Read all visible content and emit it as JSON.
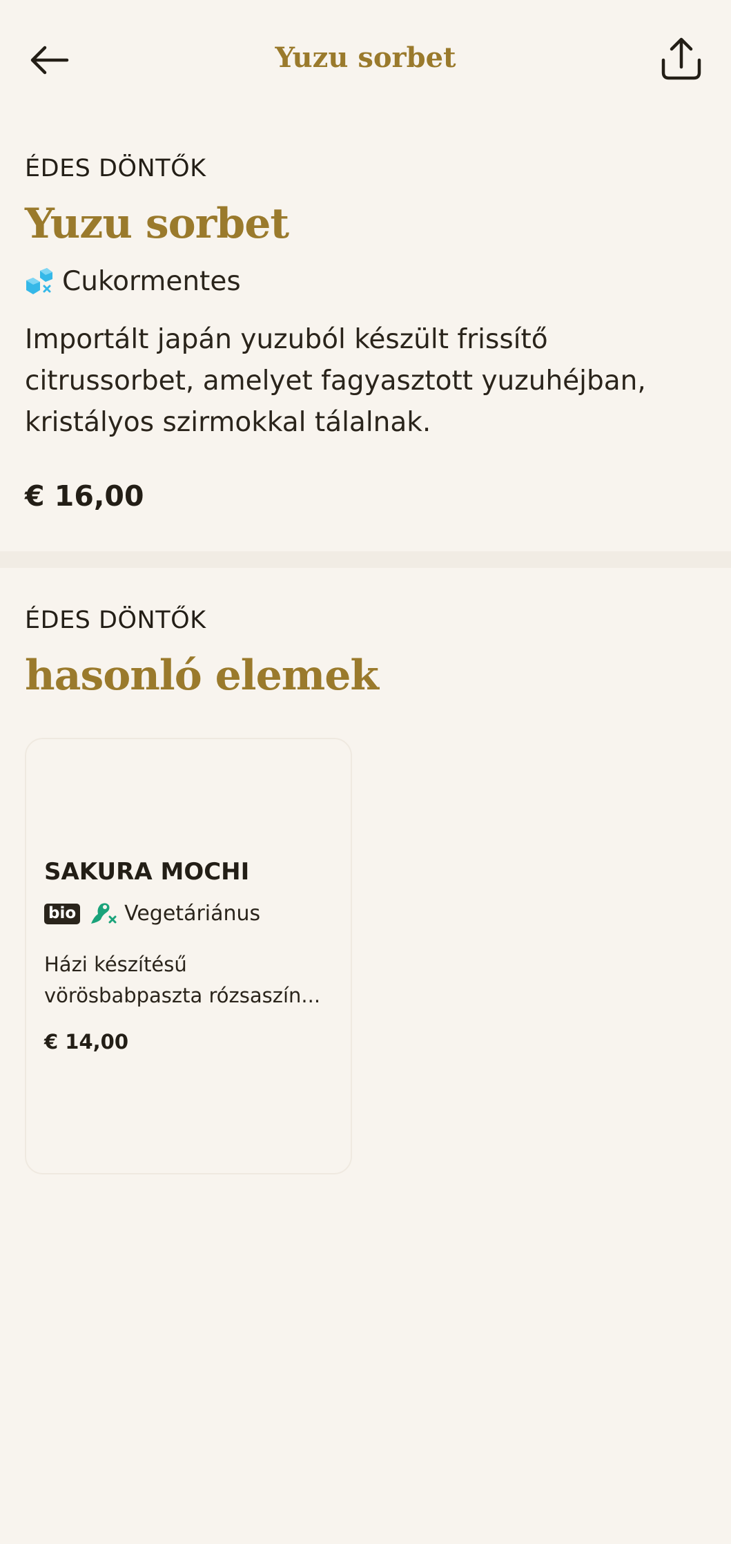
{
  "header": {
    "title": "Yuzu sorbet",
    "back_icon": "arrow-left-icon",
    "share_icon": "share-icon"
  },
  "item": {
    "category": "ÉDES DÖNTŐK",
    "name": "Yuzu sorbet",
    "tag": {
      "icon": "sugar-free-icon",
      "label": "Cukormentes"
    },
    "description": "Importált japán yuzuból készült frissítő citrussorbet, amelyet fagyasztott yuzuhéjban, kristályos szirmokkal tálalnak.",
    "price": "€ 16,00"
  },
  "similar": {
    "category": "ÉDES DÖNTŐK",
    "heading": "hasonló elemek",
    "items": [
      {
        "name": "SAKURA MOCHI",
        "badge": "bio",
        "tag": {
          "icon": "vegetarian-icon",
          "label": "Vegetáriánus"
        },
        "description_line1": "Házi készítésű",
        "description_line2": "vörösbabpaszta rózsaszín...",
        "price": "€ 14,00"
      }
    ]
  },
  "colors": {
    "background": "#f8f4ee",
    "accent_gold": "#9a7a2c",
    "text_dark": "#231e16",
    "sugar_free_blue": "#35b8e8",
    "vegetarian_green": "#1aa37a"
  }
}
